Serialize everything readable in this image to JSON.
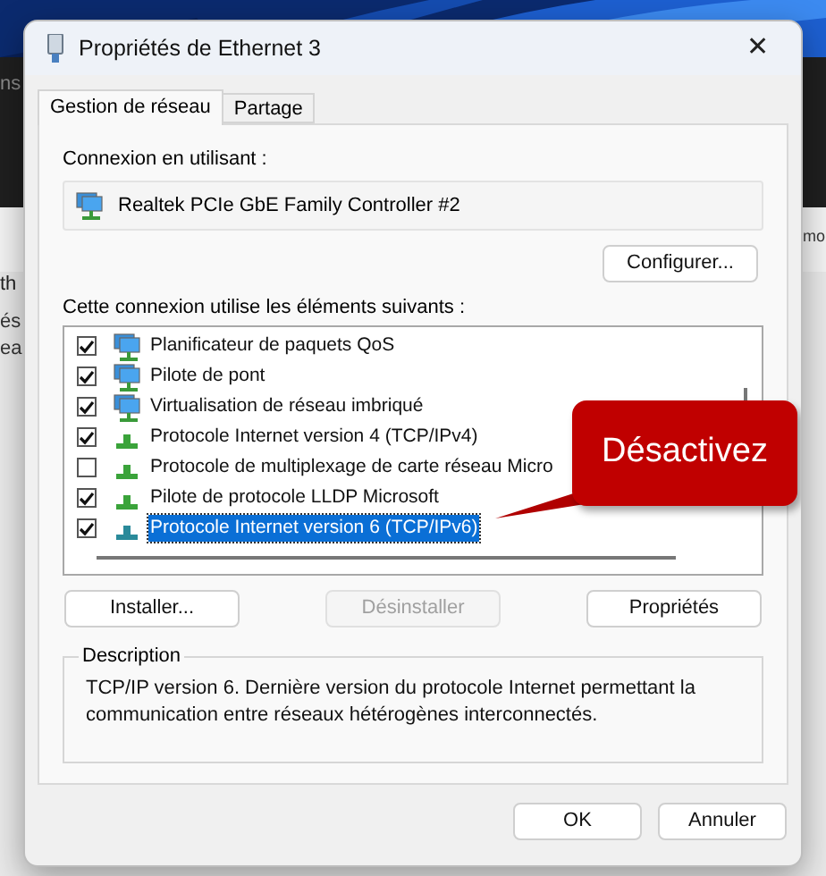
{
  "background_fragments": [
    "ns",
    "mo",
    "th",
    "és",
    "ea"
  ],
  "window": {
    "title": "Propriétés de Ethernet 3",
    "close": "✕"
  },
  "tabs": [
    {
      "label": "Gestion de réseau",
      "selected": true
    },
    {
      "label": "Partage",
      "selected": false
    }
  ],
  "connection": {
    "label": "Connexion en utilisant :",
    "adapter": "Realtek PCIe GbE Family Controller #2",
    "button": "Configurer..."
  },
  "items_label": "Cette connexion utilise les éléments suivants :",
  "items": [
    {
      "kind": "service",
      "label": "Planificateur de paquets QoS",
      "checked": true,
      "selected": false
    },
    {
      "kind": "service",
      "label": "Pilote de pont",
      "checked": true,
      "selected": false
    },
    {
      "kind": "service",
      "label": "Virtualisation de réseau imbriqué",
      "checked": true,
      "selected": false
    },
    {
      "kind": "protocol",
      "label": "Protocole Internet version 4 (TCP/IPv4)",
      "checked": true,
      "selected": false
    },
    {
      "kind": "protocol",
      "label": "Protocole de multiplexage de carte réseau Micro",
      "checked": false,
      "selected": false
    },
    {
      "kind": "protocol",
      "label": "Pilote de protocole LLDP Microsoft",
      "checked": true,
      "selected": false
    },
    {
      "kind": "protocol",
      "label": "Protocole Internet version 6 (TCP/IPv6)",
      "checked": true,
      "selected": true
    }
  ],
  "item_buttons": [
    {
      "label": "Installer...",
      "disabled": false
    },
    {
      "label": "Désinstaller",
      "disabled": true
    },
    {
      "label": "Propriétés",
      "disabled": false
    }
  ],
  "description": {
    "legend": "Description",
    "text": "TCP/IP version 6. Dernière version du protocole Internet permettant la communication entre réseaux hétérogènes interconnectés."
  },
  "dialog_buttons": [
    "OK",
    "Annuler"
  ],
  "callout": {
    "text": "Désactivez"
  }
}
